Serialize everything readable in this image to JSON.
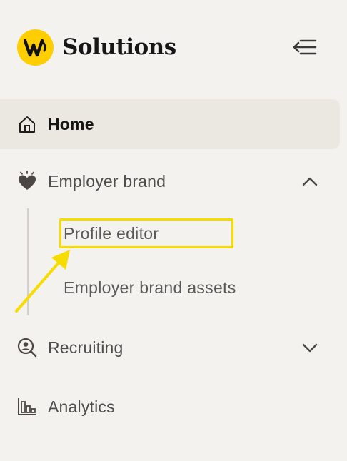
{
  "header": {
    "logo_letter": "W",
    "brand_name": "Solutions",
    "collapse_icon": "collapse-menu-icon"
  },
  "nav": {
    "home": {
      "label": "Home",
      "icon": "home-icon",
      "active": true
    },
    "employer_brand": {
      "label": "Employer brand",
      "icon": "heart-sparkle-icon",
      "expanded": true,
      "items": [
        {
          "label": "Profile editor"
        },
        {
          "label": "Employer brand assets"
        }
      ]
    },
    "recruiting": {
      "label": "Recruiting",
      "icon": "person-search-icon",
      "expanded": false
    },
    "analytics": {
      "label": "Analytics",
      "icon": "bar-chart-icon"
    }
  },
  "annotation": {
    "highlight_color": "#f7dc00"
  },
  "colors": {
    "background": "#f4f2ee",
    "active_bg": "#ebe7e1",
    "logo_yellow": "#ffce00"
  }
}
